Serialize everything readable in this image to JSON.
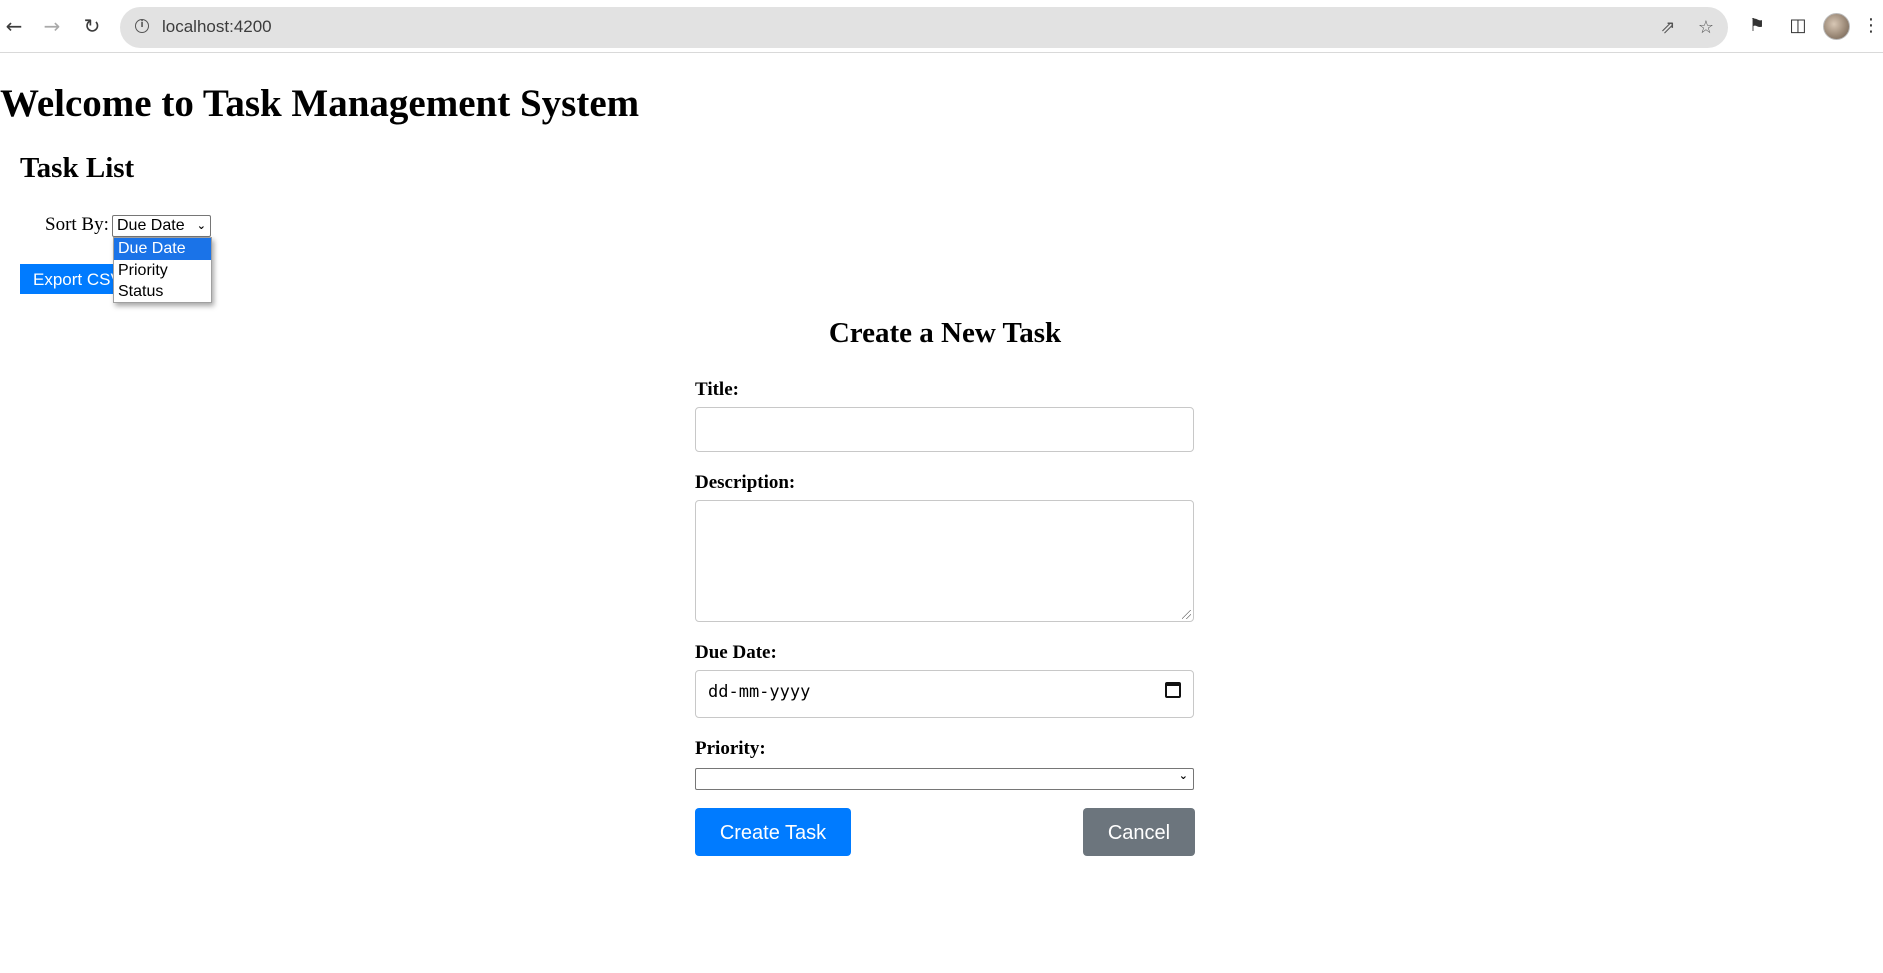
{
  "browser": {
    "url": "localhost:4200",
    "back_icon": "arrow-left-icon",
    "forward_icon": "arrow-right-icon",
    "reload_icon": "reload-icon"
  },
  "page": {
    "title": "Welcome to Task Management System",
    "task_list": {
      "heading": "Task List",
      "sort_label": "Sort By:",
      "sort_selected": "Due Date",
      "sort_options": [
        "Due Date",
        "Priority",
        "Status"
      ],
      "export_label": "Export CSV"
    },
    "form": {
      "heading": "Create a New Task",
      "title_label": "Title:",
      "title_value": "",
      "description_label": "Description:",
      "description_value": "",
      "due_date_label": "Due Date:",
      "due_date_placeholder": "dd-mm-yyyy",
      "priority_label": "Priority:",
      "priority_selected": "",
      "create_label": "Create Task",
      "cancel_label": "Cancel"
    }
  },
  "colors": {
    "primary": "#007bff",
    "secondary": "#6c757d",
    "dropdown_highlight": "#1a73e8"
  }
}
